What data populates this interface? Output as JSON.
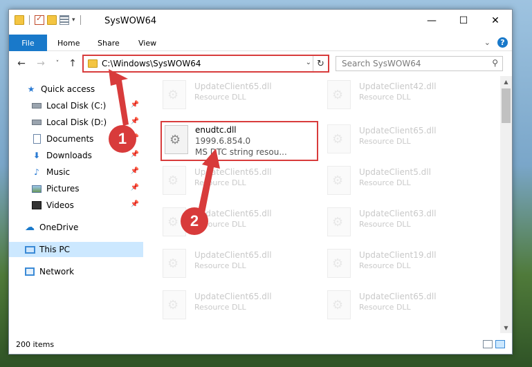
{
  "window": {
    "title": "SysWOW64",
    "controls": {
      "minimize": "—",
      "maximize": "☐",
      "close": "✕"
    }
  },
  "ribbon": {
    "tabs": [
      "File",
      "Home",
      "Share",
      "View"
    ],
    "expand_icon": "chevron-down-icon",
    "help_label": "?"
  },
  "navigation": {
    "address_path": "C:\\Windows\\SysWOW64",
    "search_placeholder": "Search SysWOW64"
  },
  "sidebar": {
    "items": [
      {
        "label": "Quick access",
        "icon": "star-icon",
        "pinned": false,
        "selected": false
      },
      {
        "label": "Local Disk (C:)",
        "icon": "drive-icon",
        "pinned": true,
        "selected": false
      },
      {
        "label": "Local Disk (D:)",
        "icon": "drive-icon",
        "pinned": true,
        "selected": false
      },
      {
        "label": "Documents",
        "icon": "documents-icon",
        "pinned": true,
        "selected": false
      },
      {
        "label": "Downloads",
        "icon": "downloads-icon",
        "pinned": true,
        "selected": false
      },
      {
        "label": "Music",
        "icon": "music-icon",
        "pinned": true,
        "selected": false
      },
      {
        "label": "Pictures",
        "icon": "pictures-icon",
        "pinned": true,
        "selected": false
      },
      {
        "label": "Videos",
        "icon": "videos-icon",
        "pinned": true,
        "selected": false
      },
      {
        "label": "OneDrive",
        "icon": "cloud-icon",
        "pinned": false,
        "selected": false
      },
      {
        "label": "This PC",
        "icon": "computer-icon",
        "pinned": false,
        "selected": true
      },
      {
        "label": "Network",
        "icon": "network-icon",
        "pinned": false,
        "selected": false
      }
    ]
  },
  "files": {
    "left_column": [
      {
        "name": "UpdateClient65.dll",
        "desc": "Resource DLL"
      },
      {
        "name": "enudtc.dll",
        "version": "1999.6.854.0",
        "desc": "MS DTC string resou..."
      },
      {
        "name": "UpdateClient65.dll",
        "desc": "Resource DLL"
      },
      {
        "name": "UpdateClient65.dll",
        "desc": "Resource DLL"
      },
      {
        "name": "UpdateClient65.dll",
        "desc": "Resource DLL"
      },
      {
        "name": "UpdateClient65.dll",
        "desc": "Resource DLL"
      }
    ],
    "right_column": [
      {
        "name": "UpdateClient42.dll",
        "desc": "Resource DLL"
      },
      {
        "name": "UpdateClient65.dll",
        "desc": "Resource DLL"
      },
      {
        "name": "UpdateClient5.dll",
        "desc": "Resource DLL"
      },
      {
        "name": "UpdateClient63.dll",
        "desc": "Resource DLL"
      },
      {
        "name": "UpdateClient19.dll",
        "desc": "Resource DLL"
      },
      {
        "name": "UpdateClient65.dll",
        "desc": "Resource DLL"
      }
    ]
  },
  "status_bar": {
    "item_count": "200 items"
  },
  "annotations": {
    "step1": "1",
    "step2": "2",
    "highlight_color": "#d83b3b"
  }
}
